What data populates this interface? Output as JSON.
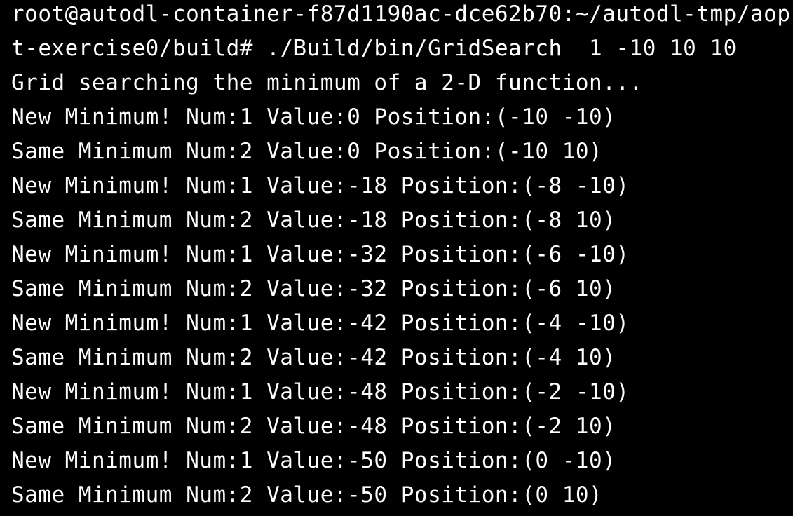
{
  "terminal": {
    "text_color": "#ffffff",
    "background_color": "#000000",
    "lines": [
      "root@autodl-container-f87d1190ac-dce62b70:~/autodl-tmp/aop",
      "t-exercise0/build# ./Build/bin/GridSearch  1 -10 10 10",
      "Grid searching the minimum of a 2-D function...",
      "New Minimum! Num:1 Value:0 Position:(-10 -10)",
      "Same Minimum Num:2 Value:0 Position:(-10 10)",
      "New Minimum! Num:1 Value:-18 Position:(-8 -10)",
      "Same Minimum Num:2 Value:-18 Position:(-8 10)",
      "New Minimum! Num:1 Value:-32 Position:(-6 -10)",
      "Same Minimum Num:2 Value:-32 Position:(-6 10)",
      "New Minimum! Num:1 Value:-42 Position:(-4 -10)",
      "Same Minimum Num:2 Value:-42 Position:(-4 10)",
      "New Minimum! Num:1 Value:-48 Position:(-2 -10)",
      "Same Minimum Num:2 Value:-48 Position:(-2 10)",
      "New Minimum! Num:1 Value:-50 Position:(0 -10)",
      "Same Minimum Num:2 Value:-50 Position:(0 10)"
    ]
  }
}
